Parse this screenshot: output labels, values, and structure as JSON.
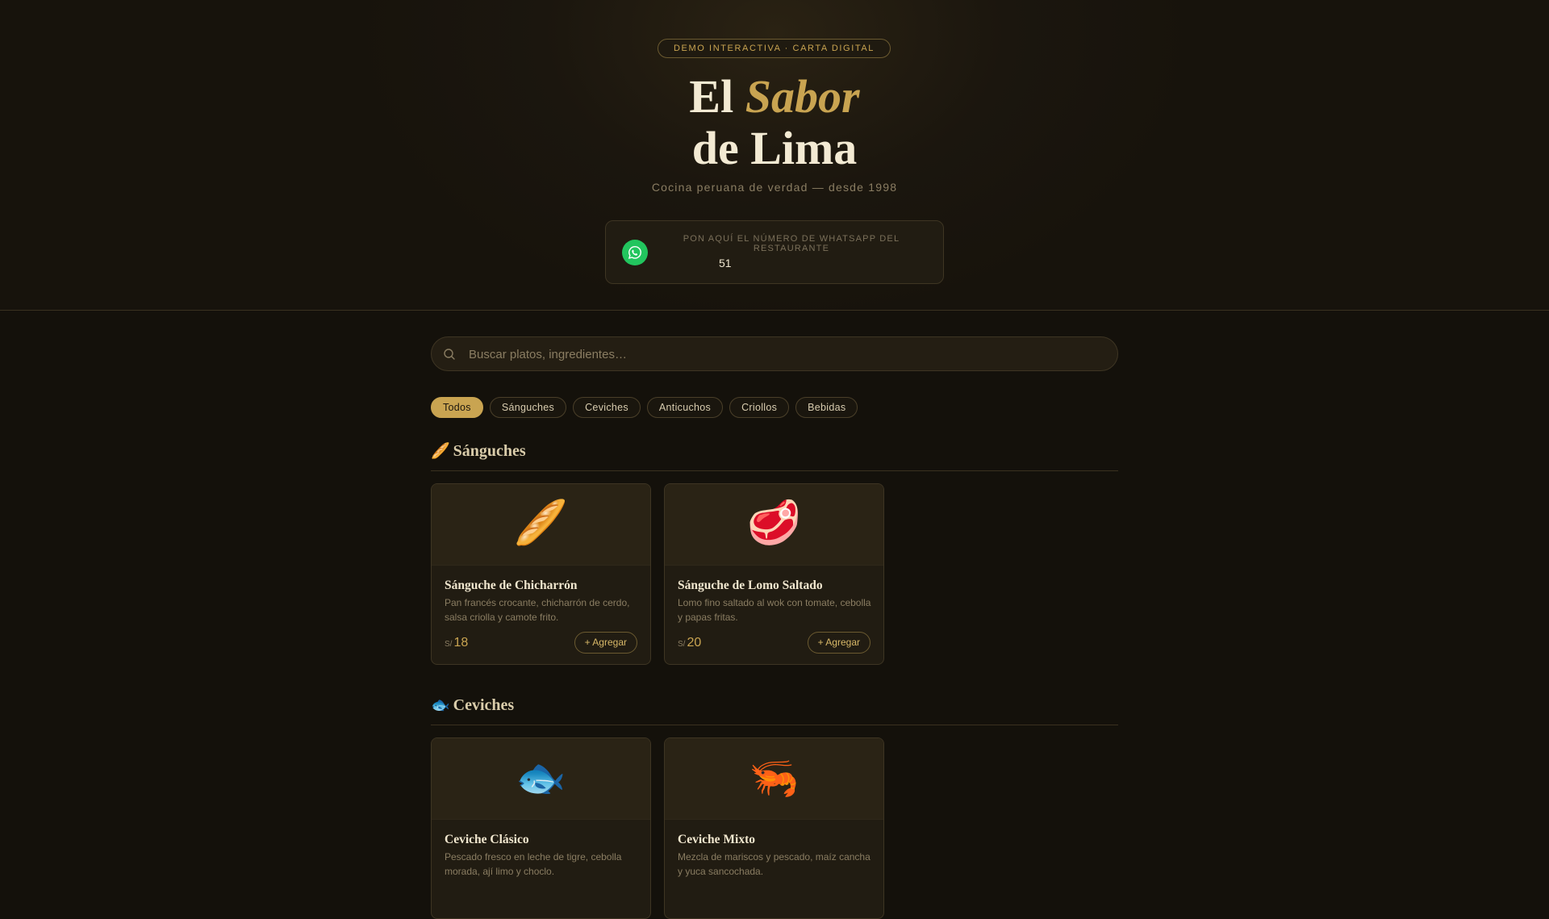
{
  "hero": {
    "badge": "DEMO INTERACTIVA · CARTA DIGITAL",
    "title_word1": "El",
    "title_accent": "Sabor",
    "title_line2": "de Lima",
    "subtitle": "Cocina peruana de verdad — desde 1998"
  },
  "whatsapp": {
    "label": "PON AQUÍ EL NÚMERO DE WHATSAPP DEL RESTAURANTE",
    "country_code": "51",
    "icon": "whatsapp-icon",
    "color": "#22c55e"
  },
  "search": {
    "placeholder": "Buscar platos, ingredientes…",
    "icon": "search-icon"
  },
  "filters": {
    "all": "Todos",
    "sanguches": "Sánguches",
    "ceviches": "Ceviches",
    "anticuchos": "Anticuchos",
    "criollos": "Criollos",
    "bebidas": "Bebidas",
    "active": "Todos"
  },
  "colors": {
    "accent": "#c9a451",
    "background": "#14110b"
  },
  "sections": {
    "sanguches": {
      "emoji": "🥖",
      "title": "Sánguches",
      "items": [
        {
          "emoji": "🥖",
          "name": "Sánguche de Chicharrón",
          "desc": "Pan francés crocante, chicharrón de cerdo, salsa criolla y camote frito.",
          "currency": "S/",
          "price": "18",
          "button": "+ Agregar"
        },
        {
          "emoji": "🥩",
          "name": "Sánguche de Lomo Saltado",
          "desc": "Lomo fino saltado al wok con tomate, cebolla y papas fritas.",
          "currency": "S/",
          "price": "20",
          "button": "+ Agregar"
        }
      ]
    },
    "ceviches": {
      "emoji": "🐟",
      "title": "Ceviches",
      "items": [
        {
          "emoji": "🐟",
          "name": "Ceviche Clásico",
          "desc": "Pescado fresco en leche de tigre, cebolla morada, ají limo y choclo."
        },
        {
          "emoji": "🦐",
          "name": "Ceviche Mixto",
          "desc": "Mezcla de mariscos y pescado, maíz cancha y yuca sancochada."
        }
      ]
    }
  }
}
